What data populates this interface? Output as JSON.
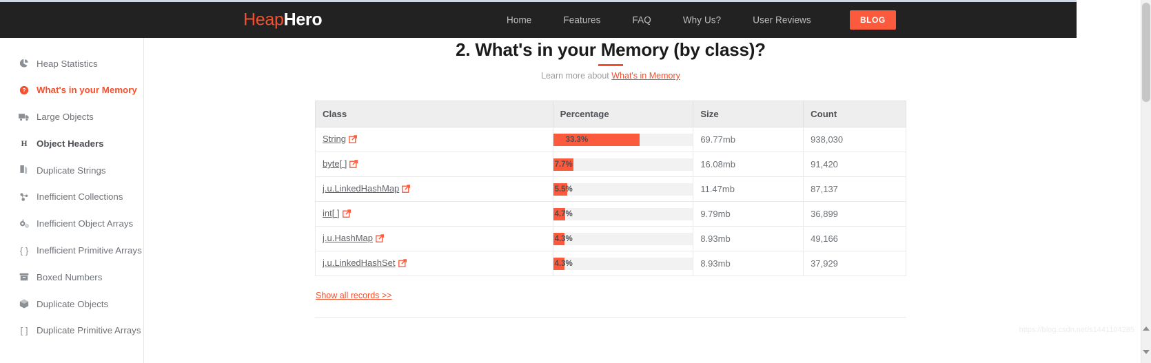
{
  "brand": {
    "part1": "Heap",
    "part2": "Hero"
  },
  "nav": {
    "links": [
      {
        "label": "Home",
        "name": "nav-link-home"
      },
      {
        "label": "Features",
        "name": "nav-link-features"
      },
      {
        "label": "FAQ",
        "name": "nav-link-faq"
      },
      {
        "label": "Why Us?",
        "name": "nav-link-why-us"
      },
      {
        "label": "User Reviews",
        "name": "nav-link-user-reviews"
      }
    ],
    "blog_label": "BLOG"
  },
  "sidebar": {
    "items": [
      {
        "label": "Heap Statistics",
        "icon": "pie-chart-icon",
        "state": "normal"
      },
      {
        "label": "What's in your Memory",
        "icon": "question-circle-icon",
        "state": "active"
      },
      {
        "label": "Large Objects",
        "icon": "truck-icon",
        "state": "normal"
      },
      {
        "label": "Object Headers",
        "icon": "letter-h-icon",
        "state": "strong"
      },
      {
        "label": "Duplicate Strings",
        "icon": "copy-icon",
        "state": "normal"
      },
      {
        "label": "Inefficient Collections",
        "icon": "molecule-icon",
        "state": "normal"
      },
      {
        "label": "Inefficient Object Arrays",
        "icon": "gears-icon",
        "state": "normal"
      },
      {
        "label": "Inefficient Primitive Arrays",
        "icon": "curly-braces-icon",
        "state": "normal"
      },
      {
        "label": "Boxed Numbers",
        "icon": "box-archive-icon",
        "state": "normal"
      },
      {
        "label": "Duplicate Objects",
        "icon": "cube-icon",
        "state": "normal"
      },
      {
        "label": "Duplicate Primitive Arrays",
        "icon": "square-brackets-icon",
        "state": "normal"
      }
    ]
  },
  "main": {
    "title": "2. What's in your Memory (by class)?",
    "subtitle_prefix": "Learn more about ",
    "subtitle_link": "What's in Memory",
    "show_all_label": "Show all records >>"
  },
  "chart_data": {
    "type": "table",
    "title": "2. What's in your Memory (by class)?",
    "columns": [
      "Class",
      "Percentage",
      "Size",
      "Count"
    ],
    "rows": [
      {
        "class": "String",
        "percentage": "33.3%",
        "percent_value": 33.3,
        "size": "69.77mb",
        "count": "938,030"
      },
      {
        "class": "byte[ ]",
        "percentage": "7.7%",
        "percent_value": 7.7,
        "size": "16.08mb",
        "count": "91,420"
      },
      {
        "class": "j.u.LinkedHashMap",
        "percentage": "5.5%",
        "percent_value": 5.5,
        "size": "11.47mb",
        "count": "87,137"
      },
      {
        "class": "int[ ]",
        "percentage": "4.7%",
        "percent_value": 4.7,
        "size": "9.79mb",
        "count": "36,899"
      },
      {
        "class": "j.u.HashMap",
        "percentage": "4.3%",
        "percent_value": 4.3,
        "size": "8.93mb",
        "count": "49,166"
      },
      {
        "class": "j.u.LinkedHashSet",
        "percentage": "4.3%",
        "percent_value": 4.3,
        "size": "8.93mb",
        "count": "37,929"
      }
    ],
    "bar_max_percent": 33.3,
    "bar_color": "#fb5a3c",
    "bar_track_color": "#f2f2f2"
  },
  "colors": {
    "accent": "#f4502d",
    "navbar": "#222222",
    "blog_button": "#fb5a3c"
  },
  "watermark": "https://blog.csdn.net/s1441104285"
}
